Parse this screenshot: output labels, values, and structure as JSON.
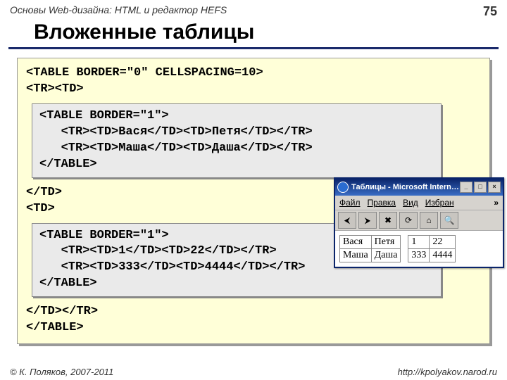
{
  "header": {
    "breadcrumb": "Основы Web-дизайна: HTML и редактор HEFS",
    "page_number": "75"
  },
  "title": "Вложенные таблицы",
  "code": {
    "outer_open1": "<TABLE BORDER=\"0\" CELLSPACING=10>",
    "outer_open2": "<TR><TD>",
    "inner1_l1": "<TABLE BORDER=\"1\">",
    "inner1_l2": "   <TR><TD>Вася</TD><TD>Петя</TD></TR>",
    "inner1_l3": "   <TR><TD>Маша</TD><TD>Даша</TD></TR>",
    "inner1_l4": "</TABLE>",
    "mid1": "</TD>",
    "mid2": "<TD>",
    "inner2_l1": "<TABLE BORDER=\"1\">",
    "inner2_l2": "   <TR><TD>1</TD><TD>22</TD></TR>",
    "inner2_l3": "   <TR><TD>333</TD><TD>4444</TD></TR>",
    "inner2_l4": "</TABLE>",
    "close1": "</TD></TR>",
    "close2": "</TABLE>"
  },
  "browser": {
    "title": "Таблицы - Microsoft Intern…",
    "menu": {
      "file": "Файл",
      "edit": "Правка",
      "view": "Вид",
      "fav": "Избран",
      "more": "»"
    },
    "win": {
      "min": "_",
      "max": "□",
      "close": "×"
    },
    "table1": {
      "r1c1": "Вася",
      "r1c2": "Петя",
      "r2c1": "Маша",
      "r2c2": "Даша"
    },
    "table2": {
      "r1c1": "1",
      "r1c2": "22",
      "r2c1": "333",
      "r2c2": "4444"
    }
  },
  "footer": {
    "copyright": "© К. Поляков, 2007-2011",
    "url": "http://kpolyakov.narod.ru"
  }
}
